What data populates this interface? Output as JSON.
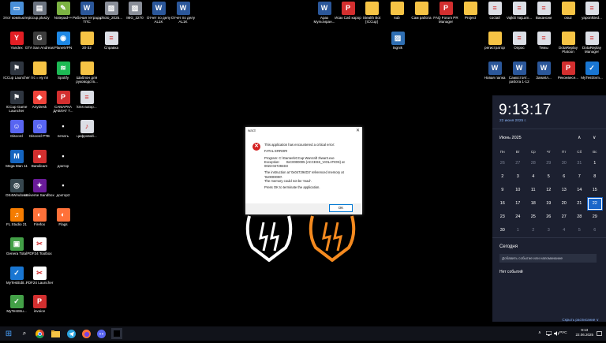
{
  "desktop": {
    "icons": [
      {
        "label": "Этот компьютер",
        "icon": "computer-icon",
        "color": "#4a90d9",
        "glyph": "▭"
      },
      {
        "label": "iccup.pluszy",
        "icon": "file-icon",
        "color": "#6c7480",
        "glyph": "▤"
      },
      {
        "label": "Notepad++",
        "icon": "notepad-icon",
        "color": "#7cb342",
        "glyph": "✎"
      },
      {
        "label": "Рабочая тетрадь ТПС",
        "icon": "word-doc-icon",
        "color": "#2b579a",
        "glyph": "W"
      },
      {
        "label": "photo_2025...",
        "icon": "image-icon",
        "color": "#8a8f99",
        "glyph": "▨"
      },
      {
        "label": "IMG_3270",
        "icon": "image-icon",
        "color": "#8a8f99",
        "glyph": "▨"
      },
      {
        "label": "Отчет по делу AL1K",
        "icon": "word-doc-icon",
        "color": "#2b579a",
        "glyph": "W"
      },
      {
        "label": "Отчет по делу AL1K",
        "icon": "word-doc-icon",
        "color": "#2b579a",
        "glyph": "W"
      },
      {
        "label": "Yandex",
        "icon": "yandex-icon",
        "color": "#e31e24",
        "glyph": "Y"
      },
      {
        "label": "GTA San Andreas",
        "icon": "gta-icon",
        "color": "#3d3d3d",
        "glyph": "G"
      },
      {
        "label": "PlanetVPN",
        "icon": "vpn-icon",
        "color": "#1e88e5",
        "glyph": "◉"
      },
      {
        "label": "20-32",
        "icon": "folder-icon",
        "color": "#f6c445",
        "glyph": "▬"
      },
      {
        "label": "Справка",
        "icon": "document-icon",
        "color": "#dcdfe6",
        "glyph": "≡"
      },
      {
        "label": "ICCup Launcher",
        "icon": "iccup-icon",
        "color": "#2f3640",
        "glyph": "⚑"
      },
      {
        "label": "гтс = ну пл",
        "icon": "folder-icon",
        "color": "#f6c445",
        "glyph": "▬"
      },
      {
        "label": "Spotify",
        "icon": "spotify-icon",
        "color": "#1db954",
        "glyph": "≋"
      },
      {
        "label": "Шаблон для руководств...",
        "icon": "folder-icon",
        "color": "#f6c445",
        "glyph": "▬"
      },
      {
        "label": "ICCup Game Launcher",
        "icon": "iccup-icon",
        "color": "#2f3640",
        "glyph": "⚑"
      },
      {
        "label": "AnyDesk",
        "icon": "anydesk-icon",
        "color": "#ef443b",
        "glyph": "◆"
      },
      {
        "label": "САМАРКА ДАВЛАТ Т...",
        "icon": "pdf-icon",
        "color": "#d32f2f",
        "glyph": "P"
      },
      {
        "label": "kms-autop...",
        "icon": "file-icon",
        "color": "#dcdfe6",
        "glyph": "≡"
      },
      {
        "label": "Discord",
        "icon": "discord-icon",
        "color": "#5865f2",
        "glyph": "☺"
      },
      {
        "label": "Discord PTB",
        "icon": "discord-icon",
        "color": "#5865f2",
        "glyph": "☺"
      },
      {
        "label": "печать",
        "icon": "printer-icon",
        "color": "#000000",
        "glyph": "▪"
      },
      {
        "label": "цифровой...",
        "icon": "audio-file-icon",
        "color": "#dcdfe6",
        "glyph": "♪"
      },
      {
        "label": "Mega Man 11",
        "icon": "game-icon",
        "color": "#1565c0",
        "glyph": "M"
      },
      {
        "label": "Bandicam",
        "icon": "bandicam-icon",
        "color": "#d32f2f",
        "glyph": "●"
      },
      {
        "label": "доктор",
        "icon": "app-icon",
        "color": "#000000",
        "glyph": "▪"
      },
      {
        "label": "DS4Windows",
        "icon": "gamepad-icon",
        "color": "#37474f",
        "glyph": "◎"
      },
      {
        "label": "Universe Sandbox",
        "icon": "universe-icon",
        "color": "#6a1b9a",
        "glyph": "✦"
      },
      {
        "label": "доктор2",
        "icon": "app-icon",
        "color": "#000000",
        "glyph": "▪"
      },
      {
        "label": "FL Studio 21",
        "icon": "fl-studio-icon",
        "color": "#f57c00",
        "glyph": "♫"
      },
      {
        "label": "Firefox",
        "icon": "firefox-icon",
        "color": "#ff7139",
        "glyph": "◐"
      },
      {
        "label": "Flags",
        "icon": "firefox-icon",
        "color": "#ff7139",
        "glyph": "◐"
      },
      {
        "label": "Genera Total",
        "icon": "genera-icon",
        "color": "#43a047",
        "glyph": "▣"
      },
      {
        "label": "PDF24 Toolbox",
        "icon": "pdf24-icon",
        "color": "#ffffff",
        "glyph": "✂"
      },
      {
        "label": "MyTestEdit...",
        "icon": "mytest-icon",
        "color": "#1976d2",
        "glyph": "✓"
      },
      {
        "label": "PDF24 Launcher",
        "icon": "pdf24-icon",
        "color": "#ffffff",
        "glyph": "✂"
      },
      {
        "label": "MyTestStu...",
        "icon": "mytest-icon",
        "color": "#43a047",
        "glyph": "✓"
      },
      {
        "label": "invoice",
        "icon": "pdf-icon",
        "color": "#d32f2f",
        "glyph": "P"
      }
    ],
    "right_icons": [
      {
        "label": "Араз Мультиран...",
        "icon": "word-doc-icon",
        "color": "#2b579a",
        "glyph": "W"
      },
      {
        "label": "Исак Саб карор",
        "icon": "pdf-icon",
        "color": "#d32f2f",
        "glyph": "P"
      },
      {
        "label": "Stealth Bot [ICCup]",
        "icon": "folder-icon",
        "color": "#f6c445",
        "glyph": "▬"
      },
      {
        "label": "sub",
        "icon": "folder-icon",
        "color": "#f6c445",
        "glyph": "▬"
      },
      {
        "label": "Сам работа",
        "icon": "folder-icon",
        "color": "#f6c445",
        "glyph": "▬"
      },
      {
        "label": "FAQ Forum PR Manager",
        "icon": "pdf-icon",
        "color": "#d32f2f",
        "glyph": "P"
      },
      {
        "label": "Project",
        "icon": "folder-icon",
        "color": "#f6c445",
        "glyph": "▬"
      },
      {
        "label": "coctail",
        "icon": "document-icon",
        "color": "#dcdfe6",
        "glyph": "≡"
      },
      {
        "label": "Vajkiti VajLam...",
        "icon": "document-icon",
        "color": "#dcdfe6",
        "glyph": "≡"
      },
      {
        "label": "Вакансии",
        "icon": "document-icon",
        "color": "#dcdfe6",
        "glyph": "≡"
      },
      {
        "label": "osuz",
        "icon": "folder-icon",
        "color": "#f6c445",
        "glyph": "▬"
      },
      {
        "label": "yaponlkied...",
        "icon": "document-icon",
        "color": "#dcdfe6",
        "glyph": "≡"
      },
      {
        "label": "tsgnik",
        "icon": "image-icon",
        "color": "#2f6fb3",
        "glyph": "▨"
      },
      {
        "label": "регистратор",
        "icon": "folder-icon",
        "color": "#f6c445",
        "glyph": "▬"
      },
      {
        "label": "Опрос",
        "icon": "document-icon",
        "color": "#dcdfe6",
        "glyph": "≡"
      },
      {
        "label": "Темы",
        "icon": "document-icon",
        "color": "#dcdfe6",
        "glyph": "≡"
      },
      {
        "label": "DotaReplay Platoon",
        "icon": "folder-icon",
        "color": "#f6c445",
        "glyph": "▬"
      },
      {
        "label": "DotaReplay Manager",
        "icon": "document-icon",
        "color": "#dcdfe6",
        "glyph": "≡"
      },
      {
        "label": "Новая папка",
        "icon": "word-doc-icon",
        "color": "#2b579a",
        "glyph": "W"
      },
      {
        "label": "Самостоят... работа 1-12",
        "icon": "word-doc-icon",
        "color": "#2b579a",
        "glyph": "W"
      },
      {
        "label": "ЗаяаКл...",
        "icon": "word-doc-icon",
        "color": "#2b579a",
        "glyph": "W"
      },
      {
        "label": "Реконвесе...",
        "icon": "pdf-icon",
        "color": "#d32f2f",
        "glyph": "P"
      },
      {
        "label": "MyTestSvm...",
        "icon": "mytest-icon",
        "color": "#1976d2",
        "glyph": "✓"
      }
    ]
  },
  "dialog": {
    "title": "war3",
    "close": "✕",
    "error_glyph": "✕",
    "lines": [
      "This application has encountered a critical error:",
      "FATAL ERROR!",
      "Program: C:\\Games\\ICCup Warcraft 3\\war3.exe\nException:       0xC0000005 (ACCESS_VIOLATION) at\n0023:047294D3",
      "The instruction at '0x047294D3' referenced memory at\n'0x0000000'.\nThe memory could not be 'read'.",
      "Press OK to terminate the application."
    ],
    "ok_label": "OK"
  },
  "panel": {
    "time": "9:13:17",
    "date": "22 июня 2025 г.",
    "month": "Июнь 2025",
    "nav_up": "∧",
    "nav_down": "∨",
    "weekdays": [
      "Пн",
      "Вт",
      "Ср",
      "Чт",
      "Пт",
      "Сб",
      "Вс"
    ],
    "weeks": [
      [
        "26",
        "27",
        "28",
        "29",
        "30",
        "31",
        "1"
      ],
      [
        "2",
        "3",
        "4",
        "5",
        "6",
        "7",
        "8"
      ],
      [
        "9",
        "10",
        "11",
        "12",
        "13",
        "14",
        "15"
      ],
      [
        "16",
        "17",
        "18",
        "19",
        "20",
        "21",
        "22"
      ],
      [
        "23",
        "24",
        "25",
        "26",
        "27",
        "28",
        "29"
      ],
      [
        "30",
        "1",
        "2",
        "3",
        "4",
        "5",
        "6"
      ]
    ],
    "today_label": "Сегодня",
    "event_placeholder": "Добавить событие или напоминание",
    "no_events": "Нет событий",
    "hide_schedule": "Скрыть расписание ∨"
  },
  "taskbar": {
    "start_glyph": "⊞",
    "search_glyph": "⌕",
    "lang": "РУС",
    "clock_time": "9:13",
    "clock_date": "22.06.2025",
    "tray_chevron": "∧",
    "accent": "#1a66c9"
  }
}
